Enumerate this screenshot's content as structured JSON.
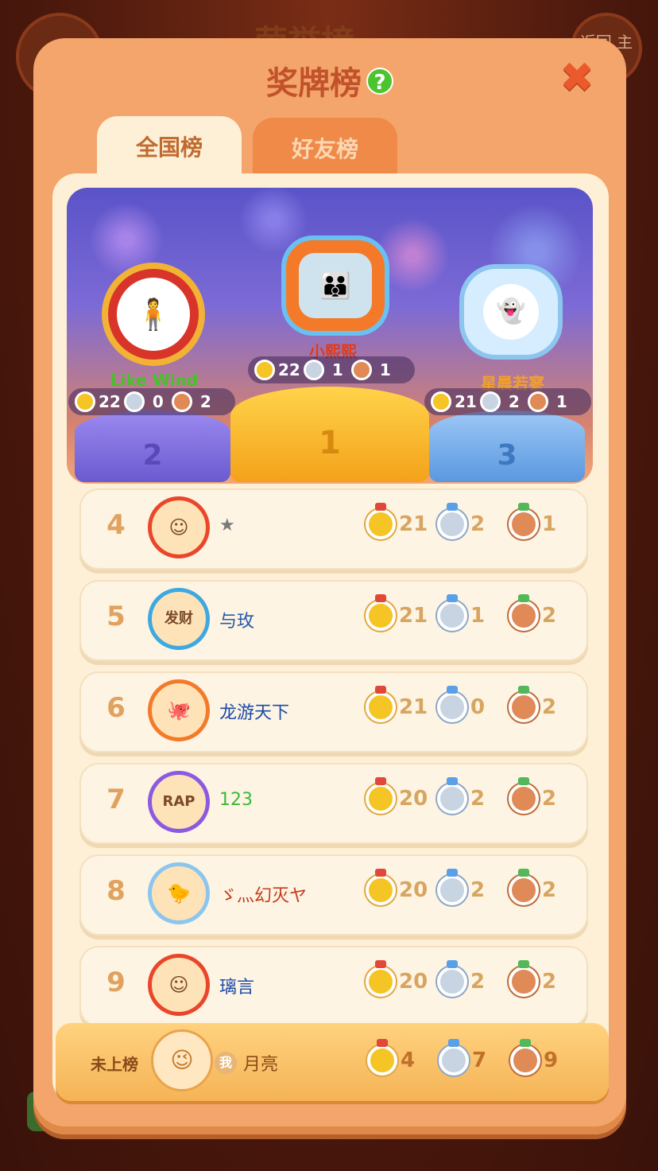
{
  "background": {
    "title": "荣誉榜",
    "back_label": "返回\n主页"
  },
  "panel": {
    "title": "奖牌榜",
    "help_symbol": "?",
    "close_symbol": "✖"
  },
  "tabs": [
    {
      "label": "全国榜",
      "active": true
    },
    {
      "label": "好友榜",
      "active": false
    }
  ],
  "podium": [
    {
      "rank": "2",
      "name": "Like Wind",
      "name_color": "#46c22a",
      "gold": "22",
      "silver": "0",
      "bronze": "2",
      "avatar_icon": "🧍"
    },
    {
      "rank": "1",
      "name": "小熙熙",
      "name_color": "#e03a1a",
      "gold": "22",
      "silver": "1",
      "bronze": "1",
      "avatar_icon": "👪"
    },
    {
      "rank": "3",
      "name": "星晨若寥",
      "name_color": "#f2a12a",
      "gold": "21",
      "silver": "2",
      "bronze": "1",
      "avatar_icon": "👻"
    }
  ],
  "rows": [
    {
      "rank": "4",
      "name": "★",
      "name_color": "#7a7a7a",
      "gold": "21",
      "silver": "2",
      "bronze": "1",
      "avatar_icon": "☺",
      "avatar_color": "#e9462a"
    },
    {
      "rank": "5",
      "name": "与玫",
      "name_color": "#2a5aa8",
      "gold": "21",
      "silver": "1",
      "bronze": "2",
      "avatar_icon": "发财",
      "avatar_color": "#3ea8e0"
    },
    {
      "rank": "6",
      "name": "龙游天下",
      "name_color": "#1a4aa8",
      "gold": "21",
      "silver": "0",
      "bronze": "2",
      "avatar_icon": "🐙",
      "avatar_color": "#f47a2a"
    },
    {
      "rank": "7",
      "name": "123",
      "name_color": "#3ab83a",
      "gold": "20",
      "silver": "2",
      "bronze": "2",
      "avatar_icon": "RAP",
      "avatar_color": "#8a5ae0"
    },
    {
      "rank": "8",
      "name": "ゞ灬幻灭ヤ",
      "name_color": "#c83a1a",
      "gold": "20",
      "silver": "2",
      "bronze": "2",
      "avatar_icon": "🐤",
      "avatar_color": "#8cc6ef"
    },
    {
      "rank": "9",
      "name": "璃言",
      "name_color": "#1a4aa8",
      "gold": "20",
      "silver": "2",
      "bronze": "2",
      "avatar_icon": "☺",
      "avatar_color": "#e9462a"
    }
  ],
  "me": {
    "status": "未上榜",
    "badge": "我",
    "name": "月亮",
    "gold": "4",
    "silver": "7",
    "bronze": "9",
    "avatar_icon": "😉"
  }
}
